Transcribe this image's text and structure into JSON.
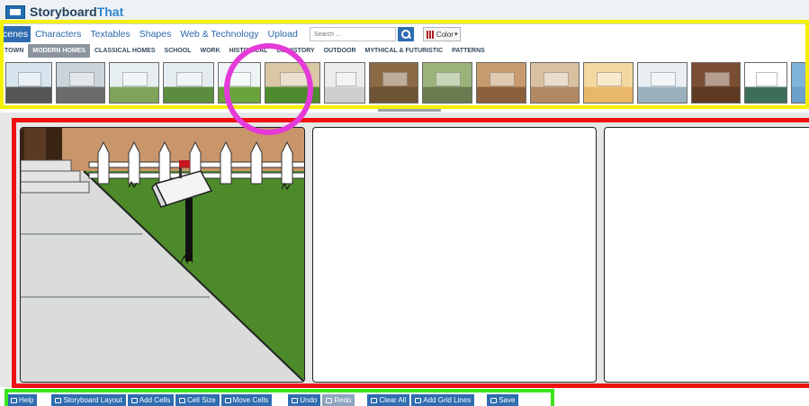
{
  "app": {
    "logo_part1": "Storyboard",
    "logo_part2": "That"
  },
  "tabs": [
    {
      "label": "cenes",
      "active": true
    },
    {
      "label": "Characters"
    },
    {
      "label": "Textables"
    },
    {
      "label": "Shapes"
    },
    {
      "label": "Web & Technology"
    },
    {
      "label": "Upload"
    }
  ],
  "search": {
    "placeholder": "Search ..."
  },
  "color_button": {
    "label": "Color"
  },
  "categories": [
    {
      "label": "TOWN"
    },
    {
      "label": "MODERN HOMES",
      "active": true
    },
    {
      "label": "CLASSICAL HOMES"
    },
    {
      "label": "SCHOOL"
    },
    {
      "label": "WORK"
    },
    {
      "label": "HISTORICAL"
    },
    {
      "label": "US HISTORY"
    },
    {
      "label": "OUTDOOR"
    },
    {
      "label": "MYTHICAL & FUTURISTIC"
    },
    {
      "label": "PATTERNS"
    }
  ],
  "thumbnails": [
    {
      "name": "street-fence",
      "sky": "#d7e6ee",
      "ground": "#555555"
    },
    {
      "name": "suburb-street",
      "sky": "#c8d4da",
      "ground": "#6b6b6b"
    },
    {
      "name": "yellow-houses",
      "sky": "#e6eef2",
      "ground": "#7ea35a"
    },
    {
      "name": "green-houses",
      "sky": "#e4ecef",
      "ground": "#5c8c3e"
    },
    {
      "name": "white-house",
      "sky": "#eef4f6",
      "ground": "#6aa33c"
    },
    {
      "name": "sidewalk-fence",
      "sky": "#d9c7a5",
      "ground": "#4e8b2e"
    },
    {
      "name": "white-wall",
      "sky": "#ececec",
      "ground": "#cfcfcf"
    },
    {
      "name": "brown-doors",
      "sky": "#8b6a46",
      "ground": "#6f5335"
    },
    {
      "name": "green-room",
      "sky": "#9bb37a",
      "ground": "#6a7c4f"
    },
    {
      "name": "stairs-room",
      "sky": "#c79b6d",
      "ground": "#8a5f3c"
    },
    {
      "name": "hallway",
      "sky": "#d9c1a0",
      "ground": "#b08963"
    },
    {
      "name": "bedroom-dresser",
      "sky": "#f2d9a0",
      "ground": "#e9b76a"
    },
    {
      "name": "blue-bedroom",
      "sky": "#e8eef2",
      "ground": "#9bb0bd"
    },
    {
      "name": "library",
      "sky": "#7a4e32",
      "ground": "#5e3a23"
    },
    {
      "name": "tv-room-green",
      "sky": "#ffffff",
      "ground": "#3e6f5a"
    },
    {
      "name": "kids-bedroom",
      "sky": "#7fb3da",
      "ground": "#6aa0c9"
    },
    {
      "name": "pink-room",
      "sky": "#ffffff",
      "ground": "#f4a6d9"
    },
    {
      "name": "purple-room",
      "sky": "#d8b9e6",
      "ground": "#c796d8"
    },
    {
      "name": "garage",
      "sky": "#e8e8e8",
      "ground": "#8c8c8c"
    }
  ],
  "toolbar": {
    "buttons": [
      {
        "label": "Help"
      },
      {
        "label": "Storyboard Layout"
      },
      {
        "label": "Add Cells"
      },
      {
        "label": "Cell Size"
      },
      {
        "label": "Move Cells"
      },
      {
        "label": "Undo"
      },
      {
        "label": "Redo",
        "disabled": true
      },
      {
        "label": "Clear All"
      },
      {
        "label": "Add Grid Lines"
      },
      {
        "label": "Save"
      }
    ]
  },
  "colors": {
    "yellow_highlight": "#f3f000",
    "magenta_highlight": "#e53ad8",
    "red_highlight": "#ef1111",
    "green_highlight": "#3be51a",
    "brand_blue": "#2f6db0"
  }
}
